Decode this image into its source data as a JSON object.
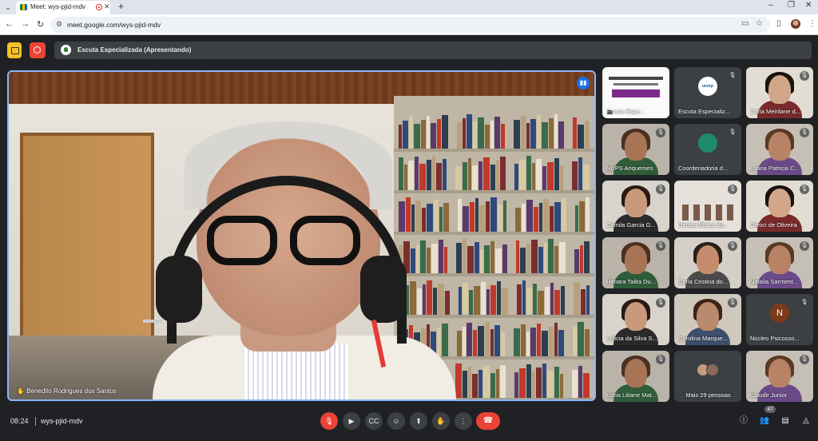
{
  "browser": {
    "tab_title": "Meet: wys-pjid-mdv",
    "url": "meet.google.com/wys-pjid-mdv"
  },
  "meet": {
    "presenting_label": "Escuta Especializada (Apresentando)",
    "main_speaker_name": "Benedito Rodrigues dos Santos",
    "tiles": [
      {
        "name": "Escuta Espe...",
        "kind": "screen"
      },
      {
        "name": "Escuta Especializ...",
        "kind": "logo",
        "logo_text": "ucorp"
      },
      {
        "name": "Carla Meirilane d...",
        "kind": "person"
      },
      {
        "name": "NUPS Ariquemes",
        "kind": "person"
      },
      {
        "name": "Coordenadoria d...",
        "kind": "green"
      },
      {
        "name": "Luana Patricia C...",
        "kind": "person"
      },
      {
        "name": "Camila Garcia G...",
        "kind": "person"
      },
      {
        "name": "Denise Eloisa da...",
        "kind": "group"
      },
      {
        "name": "Cleoci de Oliveira",
        "kind": "person"
      },
      {
        "name": "Hanara Talita Du...",
        "kind": "person"
      },
      {
        "name": "Carla Cristina do...",
        "kind": "person"
      },
      {
        "name": "Natalia Sarment...",
        "kind": "person"
      },
      {
        "name": "Leticia da Silva S...",
        "kind": "person"
      },
      {
        "name": "Carolina Marque...",
        "kind": "person"
      },
      {
        "name": "Núcleo Psicosso...",
        "kind": "initial",
        "initial": "N"
      },
      {
        "name": "Luzia Litiane Mat...",
        "kind": "person"
      },
      {
        "name": "Mais 29 pessoas",
        "kind": "more"
      },
      {
        "name": "Claudir Junior",
        "kind": "person"
      }
    ]
  },
  "bottom": {
    "time": "08:24",
    "meeting_code": "wys-pjid-mdv",
    "participants_count": "47"
  },
  "colors": {
    "accent": "#8ab4f8",
    "hangup": "#ea4335",
    "bar_bg": "#3c4043",
    "page_bg": "#202124"
  }
}
